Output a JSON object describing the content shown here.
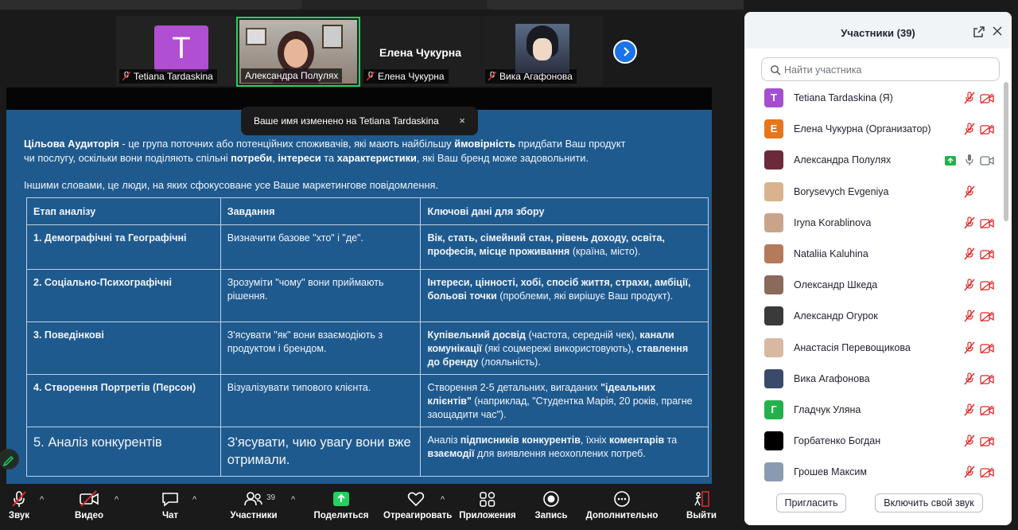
{
  "video_strip": {
    "tiles": [
      {
        "name": "Tetiana Tardaskina",
        "avatar_letter": "T"
      },
      {
        "name": "Александра Полулях"
      },
      {
        "name": "Елена Чукурна",
        "display_name": "Елена Чукурна"
      },
      {
        "name": "Вика Агафонова"
      }
    ]
  },
  "toast": {
    "message": "Ваше имя изменено на Tetiana Tardaskina",
    "close": "×"
  },
  "slide": {
    "intro1": {
      "t1": "Цільова Аудиторія",
      "t2": " - це група поточних або потенційних споживачів, які мають найбільшу ",
      "t3": "ймовірність",
      "t4": " придбати Ваш продукт"
    },
    "intro2": {
      "t1": "чи послугу, оскільки вони поділяють спільні ",
      "t2": "потреби",
      "t3": ", ",
      "t4": "інтереси",
      "t5": " та ",
      "t6": "характеристики",
      "t7": ", які Ваш бренд може задовольнити."
    },
    "intro3": "Іншими словами, це люди, на яких сфокусоване усе Ваше маркетингове повідомлення.",
    "table": {
      "headers": [
        "Етап аналізу",
        "Завдання",
        "Ключові дані для збору"
      ],
      "rows": [
        {
          "stage": "1. Демографічні та Географічні",
          "task": "Визначити базове \"хто\" і \"де\".",
          "data": [
            {
              "b": "Вік, стать, сімейний стан, рівень доходу, освіта, професія, місце проживання"
            },
            {
              "t": " (країна, місто)."
            }
          ]
        },
        {
          "stage": "2. Соціально-Психографічні",
          "task": "Зрозуміти \"чому\" вони приймають рішення.",
          "data": [
            {
              "b": "Інтереси, цінності, хобі, спосіб життя, страхи, амбіції, больові точки"
            },
            {
              "t": " (проблеми, які вирішує Ваш продукт)."
            }
          ]
        },
        {
          "stage": "3. Поведінкові",
          "task": "З'ясувати \"як\" вони взаємодіють з продуктом і брендом.",
          "data": [
            {
              "b": "Купівельний досвід"
            },
            {
              "t": " (частота, середній чек), "
            },
            {
              "b": "канали комунікації"
            },
            {
              "t": " (які соцмережі використовують), "
            },
            {
              "b": "ставлення до бренду"
            },
            {
              "t": " (лояльність)."
            }
          ]
        },
        {
          "stage": "4. Створення Портретів (Персон)",
          "task": "Візуалізувати типового клієнта.",
          "data": [
            {
              "t": "Створення 2-5 детальних, вигаданих "
            },
            {
              "b": "\"ідеальних клієнтів\""
            },
            {
              "t": " (наприклад, \"Студентка Марія, 20 років, прагне заощадити час\")."
            }
          ]
        },
        {
          "stage": "5. Аналіз конкурентів",
          "task": "З'ясувати, чию увагу вони вже отримали.",
          "data": [
            {
              "t": "Аналіз "
            },
            {
              "b": "підписників конкурентів"
            },
            {
              "t": ", їхніх "
            },
            {
              "b": "коментарів"
            },
            {
              "t": " та "
            },
            {
              "b": "взаємодії"
            },
            {
              "t": " для виявлення неохоплених потреб."
            }
          ]
        }
      ]
    }
  },
  "toolbar": {
    "mute": "Звук",
    "video": "Видео",
    "chat": "Чат",
    "participants": "Участники",
    "participants_count": "39",
    "share": "Поделиться",
    "react": "Отреагировать",
    "apps": "Приложения",
    "record": "Запись",
    "more": "Дополнительно",
    "leave": "Выйти"
  },
  "panel": {
    "title": "Участники (39)",
    "search_placeholder": "Найти участника",
    "participants": [
      {
        "name": "Tetiana Tardaskina (Я)",
        "letter": "T",
        "color": "#a44fd1"
      },
      {
        "name": "Елена Чукурна (Организатор)",
        "letter": "Е",
        "color": "#e8751a"
      },
      {
        "name": "Александра Полулях",
        "color": "#6b2a3a"
      },
      {
        "name": "Borysevych Evgeniya",
        "color": "#d9b38c"
      },
      {
        "name": "Iryna Korablinova",
        "color": "#c9a48a"
      },
      {
        "name": "Nataliia Kaluhina",
        "color": "#b57a5a"
      },
      {
        "name": "Олександр Шкеда",
        "color": "#8a6a5a"
      },
      {
        "name": "Александр Огурок",
        "color": "#3a3a3a"
      },
      {
        "name": "Анастасія Перевощикова",
        "color": "#d8b8a0"
      },
      {
        "name": "Вика Агафонова",
        "color": "#3a4a6a"
      },
      {
        "name": "Гладчук Уляна",
        "letter": "Г",
        "color": "#22b14c"
      },
      {
        "name": "Горбатенко Богдан",
        "color": "#000000"
      },
      {
        "name": "Грошев Максим",
        "color": "#8a9ab0"
      }
    ],
    "invite": "Пригласить",
    "unmute": "Включить свой звук"
  }
}
